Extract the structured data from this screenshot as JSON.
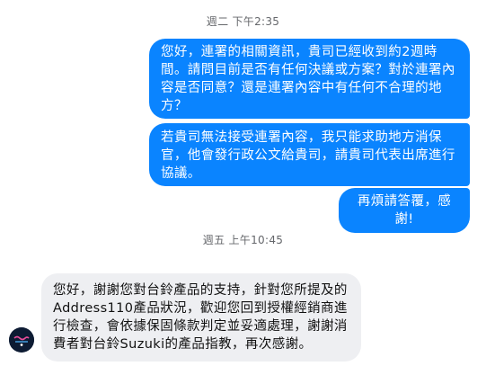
{
  "conversation": {
    "timestamps": [
      "週二 下午2:35",
      "週五 上午10:45"
    ],
    "outgoing_messages": [
      "您好，連署的相關資訊，貴司已經收到約2週時間。請問目前是否有任何決議或方案？對於連署內容是否同意？還是連署內容中有任何不合理的地方？",
      "若貴司無法接受連署內容，我只能求助地方消保官，他會發行政公文給貴司，請貴司代表出席進行協議。",
      "再煩請答覆，感謝!"
    ],
    "incoming_messages": [
      "您好，謝謝您對台鈴產品的支持，針對您所提及的Address110產品狀況，歡迎您回到授權經銷商進行檢查，會依據保固條款判定並妥適處理，謝謝消費者對台鈴Suzuki的產品指教，再次感謝。"
    ]
  },
  "colors": {
    "outgoing_bubble": "#0a84ff",
    "incoming_bubble": "#eeeff2",
    "timestamp_text": "#65676b"
  },
  "icons": {
    "sender_avatar": "brand-logo-avatar"
  }
}
